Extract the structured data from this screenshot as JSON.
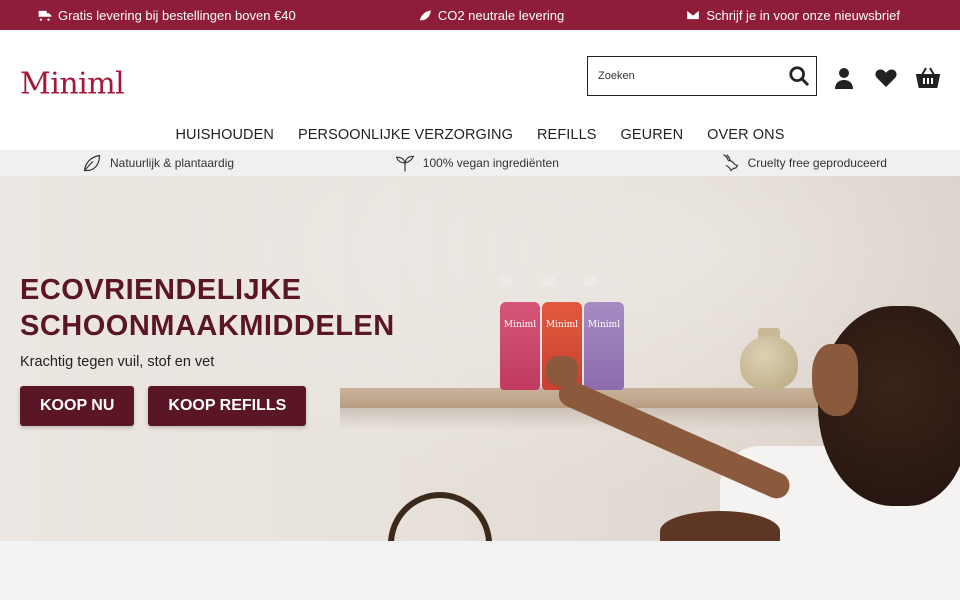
{
  "topbar": {
    "items": [
      {
        "label": "Gratis levering bij bestellingen boven €40",
        "icon": "truck-icon"
      },
      {
        "label": "CO2 neutrale levering",
        "icon": "leaf-icon"
      },
      {
        "label": "Schrijf je in voor onze nieuwsbrief",
        "icon": "envelope-icon"
      }
    ],
    "bg": "#8f1d3a"
  },
  "header": {
    "logo": "Miniml",
    "search_placeholder": "Zoeken",
    "icons": [
      "user-icon",
      "heart-icon",
      "basket-icon"
    ]
  },
  "nav": {
    "items": [
      "HUISHOUDEN",
      "PERSOONLIJKE VERZORGING",
      "REFILLS",
      "GEUREN",
      "OVER ONS"
    ]
  },
  "usp": {
    "items": [
      {
        "label": "Natuurlijk & plantaardig",
        "icon": "leaf-outline-icon"
      },
      {
        "label": "100% vegan ingrediënten",
        "icon": "sprout-icon"
      },
      {
        "label": "Cruelty free geproduceerd",
        "icon": "rabbit-icon"
      }
    ]
  },
  "hero": {
    "title_line1": "ECOVRIENDELIJKE",
    "title_line2": "SCHOONMAAKMIDDELEN",
    "subtitle": "Krachtig tegen vuil, stof en vet",
    "btn_primary": "KOOP NU",
    "btn_secondary": "KOOP REFILLS",
    "bottle_label": "Miniml",
    "accent": "#5b1626"
  }
}
